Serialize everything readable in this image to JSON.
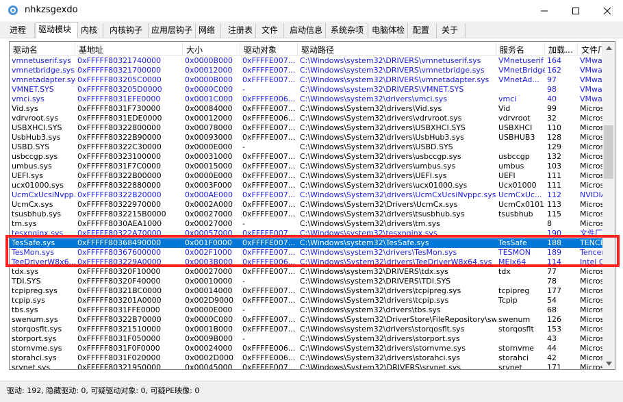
{
  "window": {
    "title": "nhkzsgexdo",
    "app_icon": "app-icon",
    "controls": [
      "minimize-icon",
      "maximize-icon",
      "close-icon"
    ]
  },
  "tabs": [
    "进程",
    "驱动模块",
    "内核",
    "内核钩子",
    "应用层钩子",
    "网络",
    "注册表",
    "文件",
    "启动信息",
    "系统杂项",
    "电脑体检",
    "配置",
    "关于"
  ],
  "active_tab": "驱动模块",
  "columns": [
    "驱动名",
    "基地址",
    "大小",
    "驱动对象",
    "驱动路径",
    "服务名",
    "加载…",
    "文件厂"
  ],
  "rows": [
    {
      "name": "vmnetuserif.sys",
      "base": "0xFFFFF80321740000",
      "size": "0x0000B000",
      "obj": "0xFFFFE007...",
      "path": "C:\\Windows\\system32\\DRIVERS\\vmnetuserif.sys",
      "svc": "VMnetuserif",
      "order": "164",
      "vendor": "VMwar",
      "color": "blue"
    },
    {
      "name": "vmnetbridge.sys",
      "base": "0xFFFFF80321700000",
      "size": "0x00012000",
      "obj": "0xFFFFE007...",
      "path": "C:\\Windows\\system32\\DRIVERS\\vmnetbridge.sys",
      "svc": "VMnetBridge",
      "order": "162",
      "vendor": "VMwar",
      "color": "blue"
    },
    {
      "name": "vmnetadapter.sys",
      "base": "0xFFFFF803205C0000",
      "size": "0x0000B000",
      "obj": "0xFFFFE007...",
      "path": "C:\\Windows\\system32\\DRIVERS\\vmnetadapter.sys",
      "svc": "VMnetAd...",
      "order": "97",
      "vendor": "VMwar",
      "color": "blue"
    },
    {
      "name": "VMNET.SYS",
      "base": "0xFFFFF803205D0000",
      "size": "0x0000C000",
      "obj": "-",
      "path": "C:\\Windows\\system32\\DRIVERS\\VMNET.SYS",
      "svc": "",
      "order": "98",
      "vendor": "VMwar",
      "color": "blue"
    },
    {
      "name": "vmci.sys",
      "base": "0xFFFFF8031EFE0000",
      "size": "0x0001C000",
      "obj": "0xFFFFE006...",
      "path": "C:\\Windows\\system32\\drivers\\vmci.sys",
      "svc": "vmci",
      "order": "40",
      "vendor": "VMwar",
      "color": "blue"
    },
    {
      "name": "Vid.sys",
      "base": "0xFFFFF8031F730000",
      "size": "0x00084000",
      "obj": "0xFFFFE007...",
      "path": "C:\\Windows\\System32\\drivers\\Vid.sys",
      "svc": "Vid",
      "order": "99",
      "vendor": "Micros",
      "color": "black"
    },
    {
      "name": "vdrvroot.sys",
      "base": "0xFFFFF8031EDE0000",
      "size": "0x00012000",
      "obj": "0xFFFFE006...",
      "path": "C:\\Windows\\System32\\drivers\\vdrvroot.sys",
      "svc": "vdrvroot",
      "order": "32",
      "vendor": "Micros",
      "color": "black"
    },
    {
      "name": "USBXHCI.SYS",
      "base": "0xFFFFF80322800000",
      "size": "0x00078000",
      "obj": "0xFFFFE007...",
      "path": "C:\\Windows\\System32\\drivers\\USBXHCI.SYS",
      "svc": "USBXHCI",
      "order": "110",
      "vendor": "Micros",
      "color": "black"
    },
    {
      "name": "UsbHub3.sys",
      "base": "0xFFFFF80322B90000",
      "size": "0x00093000",
      "obj": "0xFFFFE007...",
      "path": "C:\\Windows\\System32\\drivers\\UsbHub3.sys",
      "svc": "USBHUB3",
      "order": "128",
      "vendor": "Micros",
      "color": "black"
    },
    {
      "name": "USBD.SYS",
      "base": "0xFFFFF80322C30000",
      "size": "0x0000E000",
      "obj": "-",
      "path": "C:\\Windows\\System32\\drivers\\USBD.SYS",
      "svc": "",
      "order": "129",
      "vendor": "Micros",
      "color": "black"
    },
    {
      "name": "usbccgp.sys",
      "base": "0xFFFFF80323100000",
      "size": "0x00031000",
      "obj": "0xFFFFE007...",
      "path": "C:\\Windows\\System32\\drivers\\usbccgp.sys",
      "svc": "usbccgp",
      "order": "132",
      "vendor": "Micros",
      "color": "black"
    },
    {
      "name": "umbus.sys",
      "base": "0xFFFFF8031F7C0000",
      "size": "0x00015000",
      "obj": "0xFFFFE007...",
      "path": "C:\\Windows\\System32\\drivers\\umbus.sys",
      "svc": "umbus",
      "order": "103",
      "vendor": "Micros",
      "color": "black"
    },
    {
      "name": "UEFI.sys",
      "base": "0xFFFFF80322B00000",
      "size": "0x0000E000",
      "obj": "0xFFFFE007...",
      "path": "C:\\Windows\\System32\\drivers\\UEFI.sys",
      "svc": "UEFI",
      "order": "111",
      "vendor": "Micros",
      "color": "black"
    },
    {
      "name": "ucx01000.sys",
      "base": "0xFFFFF80322880000",
      "size": "0x0003F000",
      "obj": "0xFFFFE007...",
      "path": "C:\\Windows\\System32\\drivers\\ucx01000.sys",
      "svc": "Ucx01000",
      "order": "111",
      "vendor": "Micros",
      "color": "black"
    },
    {
      "name": "UcmCxUcsiNvpp...",
      "base": "0xFFFFF80322B20000",
      "size": "0x000AE000",
      "obj": "0xFFFFE007...",
      "path": "C:\\Windows\\System32\\drivers\\UcmCxUcsiNvppc.sys",
      "svc": "UcmCxUc...",
      "order": "112",
      "vendor": "NVIDIA",
      "color": "blue"
    },
    {
      "name": "UcmCx.sys",
      "base": "0xFFFFF80322970000",
      "size": "0x0002A000",
      "obj": "0xFFFFE007...",
      "path": "C:\\Windows\\System32\\Drivers\\UcmCx.sys",
      "svc": "UcmCx0101",
      "order": "113",
      "vendor": "Micros",
      "color": "black"
    },
    {
      "name": "tsusbhub.sys",
      "base": "0xFFFFF8032215B0000",
      "size": "0x00027000",
      "obj": "0xFFFFE007...",
      "path": "C:\\Windows\\System32\\drivers\\tsusbhub.sys",
      "svc": "tsusbhub",
      "order": "115",
      "vendor": "Micros",
      "color": "black"
    },
    {
      "name": "tm.sys",
      "base": "0xFFFFF8030AEA1000",
      "size": "0x00027000",
      "obj": "-",
      "path": "C:\\Windows\\System32\\drivers\\tm.sys",
      "svc": "",
      "order": "8",
      "vendor": "Micros",
      "color": "black"
    },
    {
      "name": "tesxnginx.sys",
      "base": "0xFFFFF80322A70000",
      "size": "0x00057000",
      "obj": "0xFFFFE007...",
      "path": "C:\\Windows\\system32\\tesxnginx.sys",
      "svc": "",
      "order": "190",
      "vendor": "文件厂",
      "color": "blue"
    },
    {
      "name": "TesSafe.sys",
      "base": "0xFFFFF80368490000",
      "size": "0x001F0000",
      "obj": "0xFFFFE007...",
      "path": "C:\\Windows\\system32\\TesSafe.sys",
      "svc": "TesSafe",
      "order": "188",
      "vendor": "TENCE",
      "color": "sel"
    },
    {
      "name": "TesMon.sys",
      "base": "0xFFFFF80367600000",
      "size": "0x002F1000",
      "obj": "0xFFFFE007...",
      "path": "C:\\Windows\\system32\\drivers\\TesMon.sys",
      "svc": "TESMON",
      "order": "189",
      "vendor": "Tencer",
      "color": "blue"
    },
    {
      "name": "TeeDriverW8x6...",
      "base": "0xFFFFF803229A0000",
      "size": "0x0003B000",
      "obj": "0xFFFFE006...",
      "path": "C:\\Windows\\System32\\drivers\\TeeDriverW8x64.sys",
      "svc": "MEIx64",
      "order": "114",
      "vendor": "Intel C",
      "color": "blue"
    },
    {
      "name": "tdx.sys",
      "base": "0xFFFFF80320F10000",
      "size": "0x00027000",
      "obj": "0xFFFFE007...",
      "path": "C:\\Windows\\system32\\DRIVERS\\tdx.sys",
      "svc": "tdx",
      "order": "77",
      "vendor": "Micros",
      "color": "black"
    },
    {
      "name": "TDI.SYS",
      "base": "0xFFFFF80320F40000",
      "size": "0x00010000",
      "obj": "-",
      "path": "C:\\Windows\\system32\\DRIVERS\\TDI.SYS",
      "svc": "",
      "order": "78",
      "vendor": "Micros",
      "color": "black"
    },
    {
      "name": "tcpipreg.sys",
      "base": "0xFFFFF80321BC0000",
      "size": "0x00014000",
      "obj": "0xFFFFE007...",
      "path": "C:\\Windows\\System32\\drivers\\tcpipreg.sys",
      "svc": "tcpipreg",
      "order": "177",
      "vendor": "Micros",
      "color": "black"
    },
    {
      "name": "tcpip.sys",
      "base": "0xFFFFF803201A0000",
      "size": "0x002D9000",
      "obj": "0xFFFFE007...",
      "path": "C:\\Windows\\System32\\drivers\\tcpip.sys",
      "svc": "Tcpip",
      "order": "54",
      "vendor": "Micros",
      "color": "black"
    },
    {
      "name": "tbs.sys",
      "base": "0xFFFFF8031FFE0000",
      "size": "0x0000E000",
      "obj": "-",
      "path": "C:\\Windows\\system32\\drivers\\tbs.sys",
      "svc": "",
      "order": "68",
      "vendor": "Micros",
      "color": "black"
    },
    {
      "name": "swenum.sys",
      "base": "0xFFFFF80322B70000",
      "size": "0x0000C000",
      "obj": "0xFFFFE007...",
      "path": "C:\\Windows\\System32\\DriverStore\\FileRepository\\swe...",
      "svc": "swenum",
      "order": "126",
      "vendor": "Micros",
      "color": "black"
    },
    {
      "name": "storqosflt.sys",
      "base": "0xFFFFF80321510000",
      "size": "0x0001B000",
      "obj": "0xFFFFE007...",
      "path": "C:\\Windows\\system32\\drivers\\storqosflt.sys",
      "svc": "storqosflt",
      "order": "153",
      "vendor": "Micros",
      "color": "black"
    },
    {
      "name": "storport.sys",
      "base": "0xFFFFF8031F050000",
      "size": "0x0009B000",
      "obj": "-",
      "path": "C:\\Windows\\System32\\drivers\\storport.sys",
      "svc": "",
      "order": "43",
      "vendor": "Micros",
      "color": "black"
    },
    {
      "name": "stornvme.sys",
      "base": "0xFFFFF8031F0F0000",
      "size": "0x00024000",
      "obj": "0xFFFFE006...",
      "path": "C:\\Windows\\System32\\drivers\\stornvme.sys",
      "svc": "stornvme",
      "order": "44",
      "vendor": "Micros",
      "color": "black"
    },
    {
      "name": "storahci.sys",
      "base": "0xFFFFF8031F020000",
      "size": "0x0002D000",
      "obj": "0xFFFFE006...",
      "path": "C:\\Windows\\System32\\drivers\\storahci.sys",
      "svc": "storahci",
      "order": "42",
      "vendor": "Micros",
      "color": "black"
    },
    {
      "name": "srvnet.sys",
      "base": "0xFFFFF80321950000",
      "size": "0x00045000",
      "obj": "0xFFFFE007...",
      "path": "C:\\Windows\\System32\\DRIVERS\\srvnet.sys",
      "svc": "srvnet",
      "order": "171",
      "vendor": "Micros",
      "color": "black"
    }
  ],
  "status": "驱动: 192, 隐藏驱动: 0, 可疑驱动对象: 0, 可疑PE映像: 0"
}
